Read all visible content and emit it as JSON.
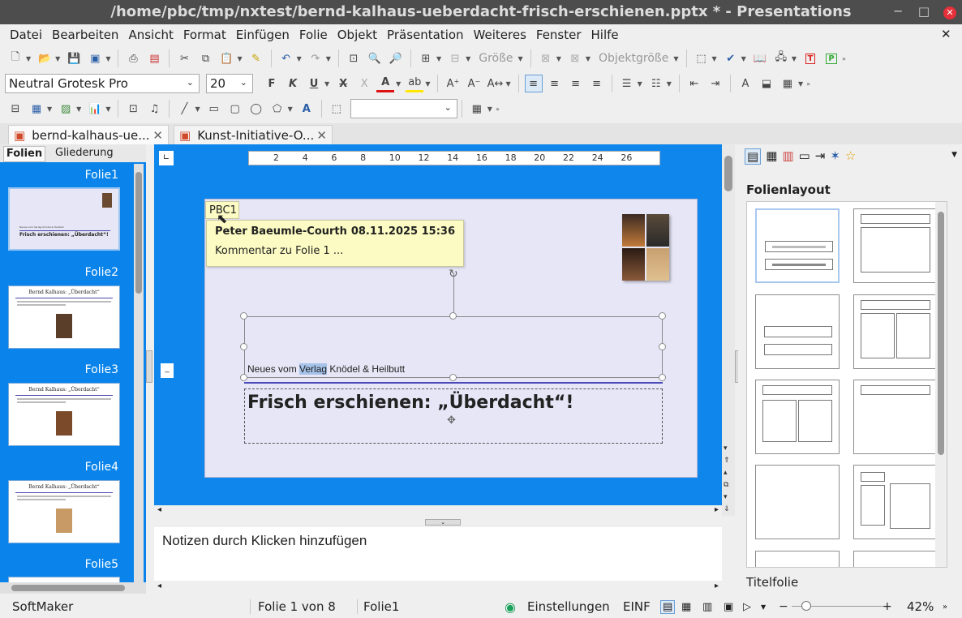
{
  "window": {
    "title": "/home/pbc/tmp/nxtest/bernd-kalhaus-ueberdacht-frisch-erschienen.pptx * - Presentations",
    "close": "✕"
  },
  "menu": [
    "Datei",
    "Bearbeiten",
    "Ansicht",
    "Format",
    "Einfügen",
    "Folie",
    "Objekt",
    "Präsentation",
    "Weiteres",
    "Fenster",
    "Hilfe"
  ],
  "toolbar": {
    "size_label": "Größe",
    "objsize_label": "Objektgröße",
    "font": "Neutral Grotesk Pro",
    "fontsize": "20"
  },
  "tabs": [
    {
      "label": "bernd-kalhaus-ue..."
    },
    {
      "label": "Kunst-Initiative-O..."
    }
  ],
  "left": {
    "tab_slides": "Folien",
    "tab_outline": "Gliederung",
    "slides": [
      "Folie1",
      "Folie2",
      "Folie3",
      "Folie4",
      "Folie5"
    ],
    "thumb_title": "Bernd Kalhaus: „Überdacht“",
    "thumb1_small": "Neues vom Verlag Knödel & Heilbutt",
    "thumb1_title": "Frisch erschienen: „Überdacht“!"
  },
  "ruler": [
    "2",
    "4",
    "6",
    "8",
    "10",
    "12",
    "14",
    "16",
    "18",
    "20",
    "22",
    "24",
    "26"
  ],
  "comment": {
    "tag": "PBC1",
    "author": "Peter Baeumle-Courth",
    "date": "08.11.2025 15:36",
    "text": "Kommentar zu Folie 1 ..."
  },
  "slide": {
    "subtitle_pre": "Neues vom ",
    "subtitle_sel": "Verlag",
    "subtitle_post": " Knödel & Heilbutt",
    "title": "Frisch erschienen: „Überdacht“!"
  },
  "notes": {
    "placeholder": "Notizen durch Klicken hinzufügen"
  },
  "right": {
    "heading": "Folienlayout",
    "current": "Titelfolie"
  },
  "status": {
    "app": "SoftMaker",
    "page": "Folie 1 von 8",
    "slide": "Folie1",
    "settings": "Einstellungen",
    "mode": "EINF",
    "zoom": "42%"
  },
  "colors": {
    "accent": "#0a84ea",
    "titlebar": "#4d4d4d",
    "note": "#fbfbc3"
  }
}
